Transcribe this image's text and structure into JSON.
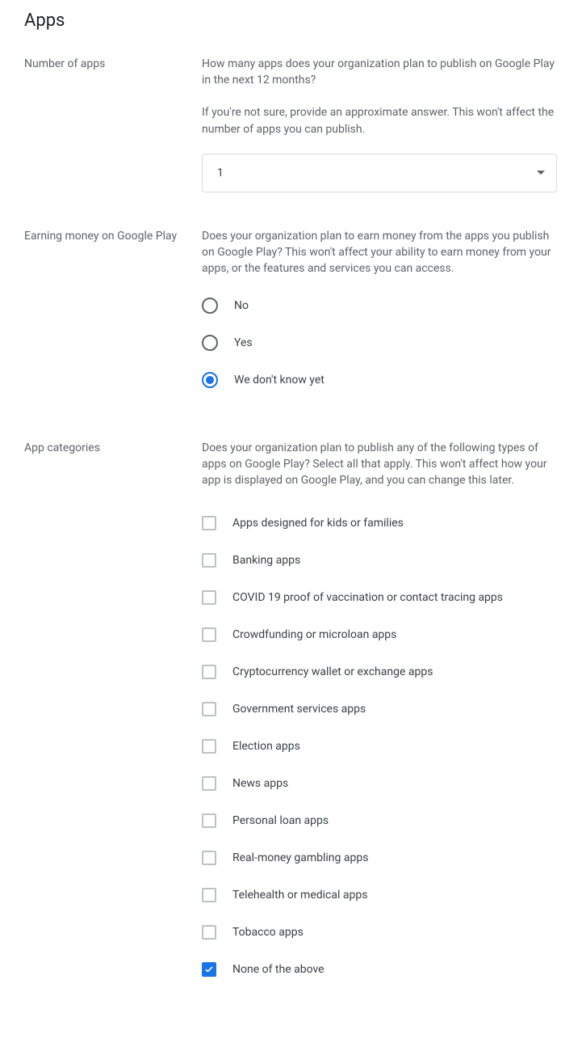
{
  "page_title": "Apps",
  "number_of_apps": {
    "label": "Number of apps",
    "desc1": "How many apps does your organization plan to publish on Google Play in the next 12 months?",
    "desc2": "If you're not sure, provide an approximate answer. This won't affect the number of apps you can publish.",
    "selected": "1"
  },
  "earning": {
    "label": "Earning money on Google Play",
    "desc": "Does your organization plan to earn money from the apps you publish on Google Play? This won't affect your ability to earn money from your apps, or the features and services you can access.",
    "options": {
      "no": "No",
      "yes": "Yes",
      "unknown": "We don't know yet"
    },
    "selected_index": 2
  },
  "categories": {
    "label": "App categories",
    "desc": "Does your organization plan to publish any of the following types of apps on Google Play? Select all that apply. This won't affect how your app is displayed on Google Play, and you can change this later.",
    "items": [
      "Apps designed for kids or families",
      "Banking apps",
      "COVID 19 proof of vaccination or contact tracing apps",
      "Crowdfunding or microloan apps",
      "Cryptocurrency wallet or exchange apps",
      "Government services apps",
      "Election apps",
      "News apps",
      "Personal loan apps",
      "Real-money gambling apps",
      "Telehealth or medical apps",
      "Tobacco apps",
      "None of the above"
    ],
    "checked_index": 12
  }
}
